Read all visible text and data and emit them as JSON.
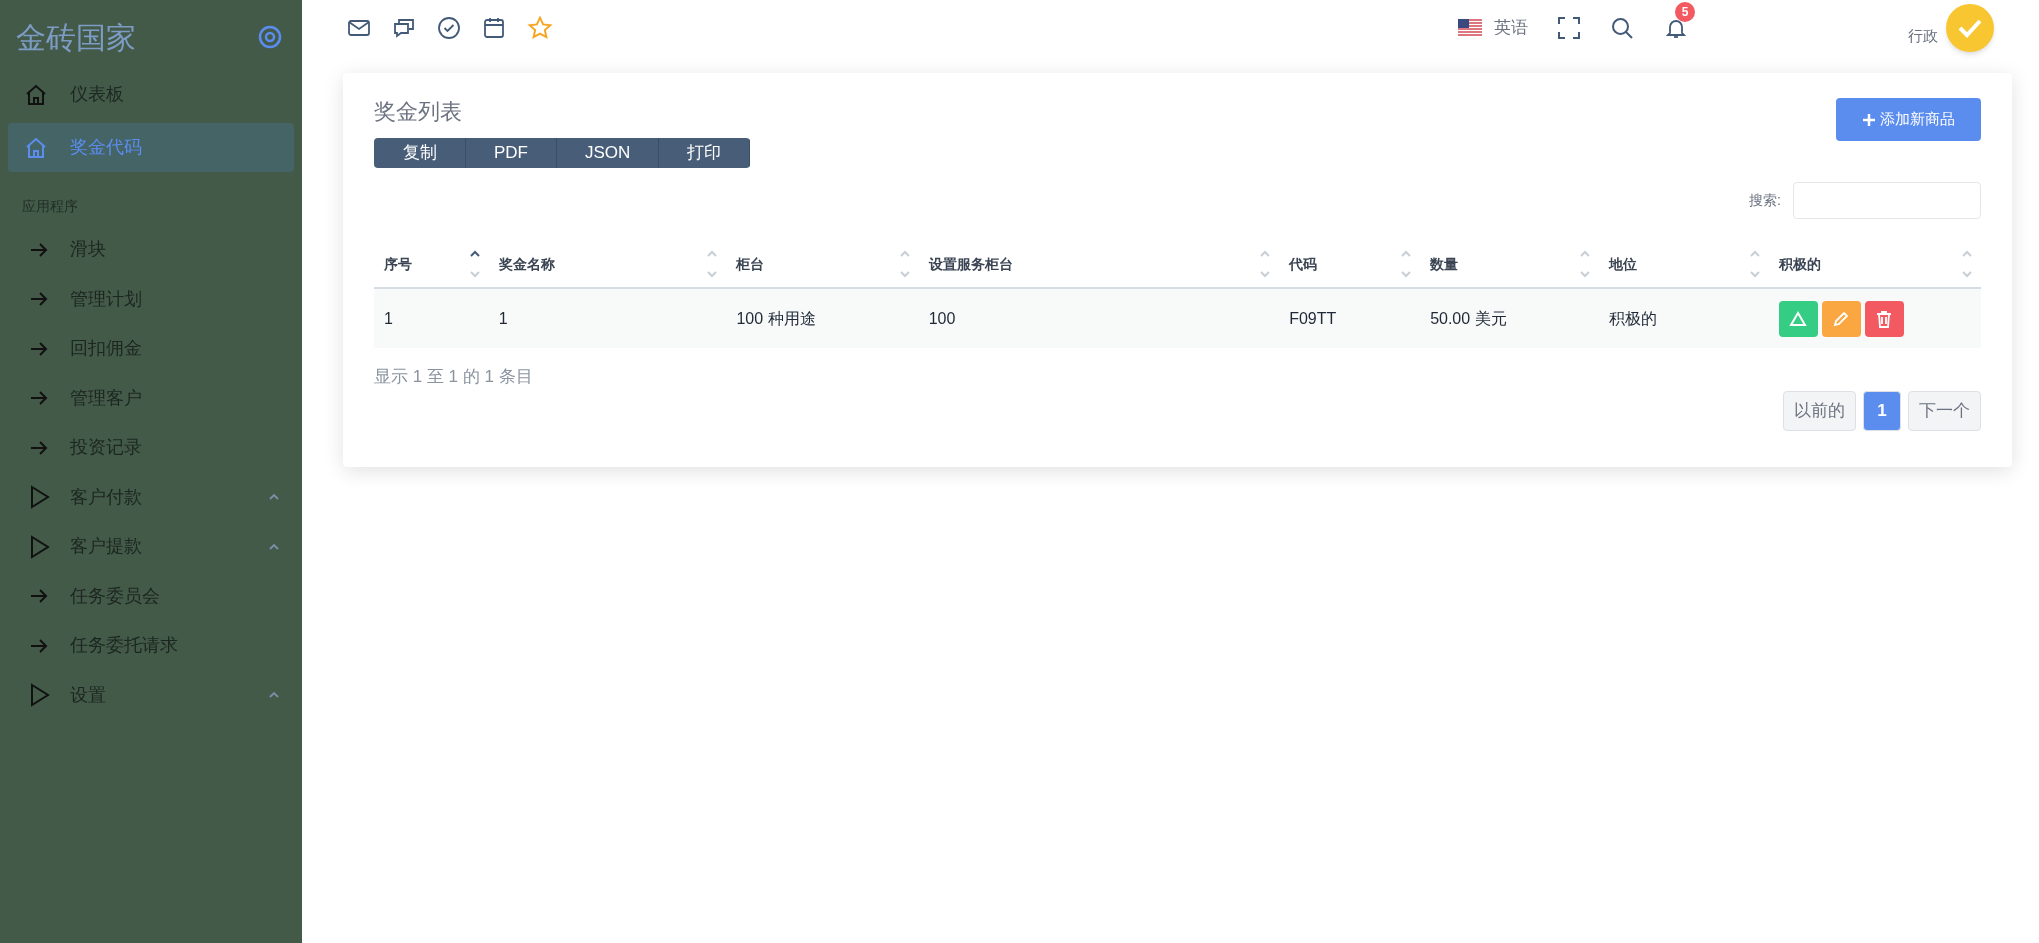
{
  "sidebar": {
    "brand": "金砖国家",
    "items": [
      {
        "label": "仪表板",
        "kind": "home",
        "selected": false
      },
      {
        "label": "奖金代码",
        "kind": "home",
        "selected": true
      }
    ],
    "section": "应用程序",
    "app_items": [
      {
        "label": "滑块",
        "kind": "arrow",
        "expanded": false
      },
      {
        "label": "管理计划",
        "kind": "arrow",
        "expanded": false
      },
      {
        "label": "回扣佣金",
        "kind": "arrow",
        "expanded": false
      },
      {
        "label": "管理客户",
        "kind": "arrow",
        "expanded": false
      },
      {
        "label": "投资记录",
        "kind": "arrow",
        "expanded": false
      },
      {
        "label": "客户付款",
        "kind": "group",
        "expanded": true
      },
      {
        "label": "客户提款",
        "kind": "group",
        "expanded": true
      },
      {
        "label": "任务委员会",
        "kind": "arrow",
        "expanded": false
      },
      {
        "label": "任务委托请求",
        "kind": "arrow",
        "expanded": false
      },
      {
        "label": "设置",
        "kind": "group",
        "expanded": true
      }
    ]
  },
  "topbar": {
    "language": "英语",
    "notification_count": "5",
    "user": "行政"
  },
  "card": {
    "title": "奖金列表",
    "export_buttons": [
      "复制",
      "PDF",
      "JSON",
      "打印"
    ],
    "add_button": "添加新商品",
    "search_label": "搜索:",
    "table": {
      "columns": [
        {
          "label": "序号",
          "sorted": true
        },
        {
          "label": "奖金名称",
          "sorted": false
        },
        {
          "label": "柜台",
          "sorted": false
        },
        {
          "label": "设置服务柜台",
          "sorted": false
        },
        {
          "label": "代码",
          "sorted": false
        },
        {
          "label": "数量",
          "sorted": false
        },
        {
          "label": "地位",
          "sorted": false
        },
        {
          "label": "积极的",
          "sorted": false
        }
      ],
      "rows": [
        {
          "cells": [
            "1",
            "1",
            "100 种用途",
            "100",
            "F09TT",
            "50.00 美元",
            "积极的"
          ]
        }
      ]
    },
    "info": "显示 1 至 1 的 1 条目",
    "pagination": {
      "previous": "以前的",
      "pages": [
        {
          "label": "1",
          "selected": true
        }
      ],
      "next": "下一个"
    }
  }
}
